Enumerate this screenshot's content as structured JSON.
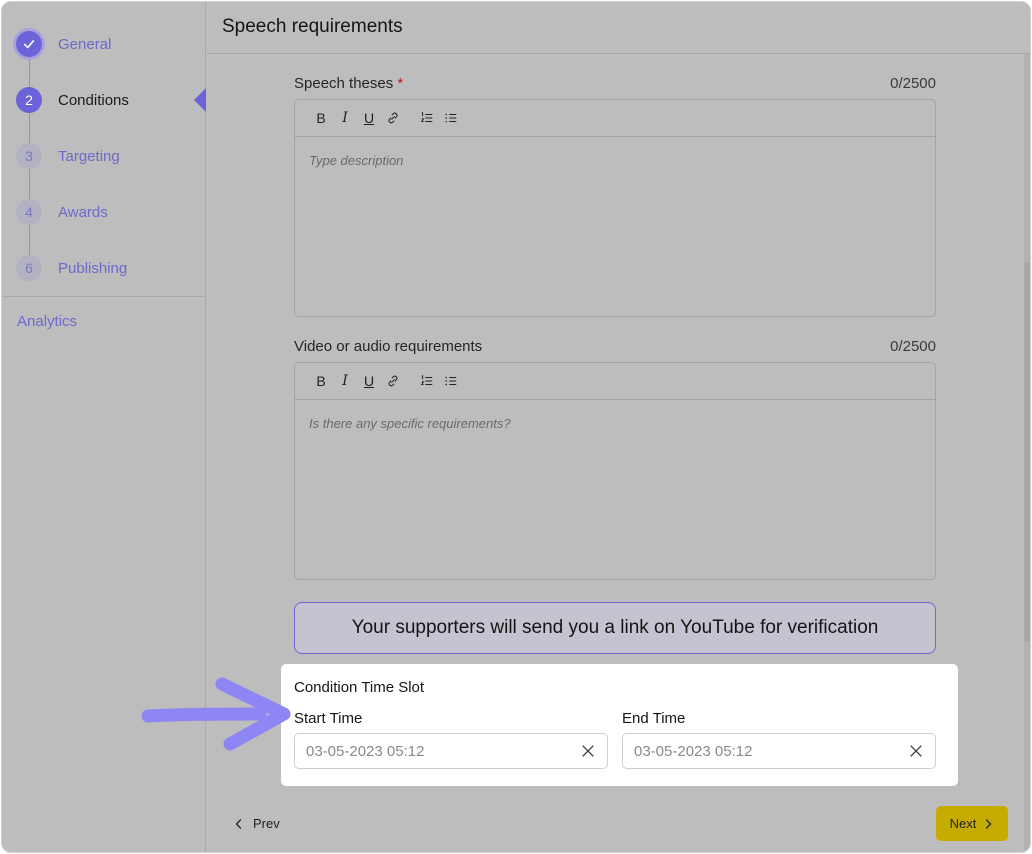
{
  "sidebar": {
    "steps": [
      {
        "number": "",
        "label": "General",
        "state": "done",
        "icon": "check-icon"
      },
      {
        "number": "2",
        "label": "Conditions",
        "state": "active"
      },
      {
        "number": "3",
        "label": "Targeting",
        "state": "pending"
      },
      {
        "number": "4",
        "label": "Awards",
        "state": "pending"
      },
      {
        "number": "6",
        "label": "Publishing",
        "state": "pending"
      }
    ],
    "analytics_label": "Analytics"
  },
  "main": {
    "title": "Speech requirements",
    "speech_theses": {
      "label": "Speech theses",
      "required_mark": "*",
      "counter": "0/2500",
      "placeholder": "Type description"
    },
    "media_requirements": {
      "label": "Video or audio requirements",
      "counter": "0/2500",
      "placeholder": "Is there any specific requirements?"
    },
    "toolbar": {
      "bold": "B",
      "italic": "I",
      "underline": "U"
    },
    "info_banner": "Your supporters will send you a link on YouTube for verification",
    "time_slot": {
      "title": "Condition Time Slot",
      "start_label": "Start Time",
      "start_value": "03-05-2023 05:12",
      "end_label": "End Time",
      "end_value": "03-05-2023 05:12"
    }
  },
  "footer": {
    "prev_label": "Prev",
    "next_label": "Next"
  },
  "colors": {
    "accent": "#6c63d9",
    "next_button": "#c6ab00",
    "highlight_arrow": "#8d86f4"
  }
}
